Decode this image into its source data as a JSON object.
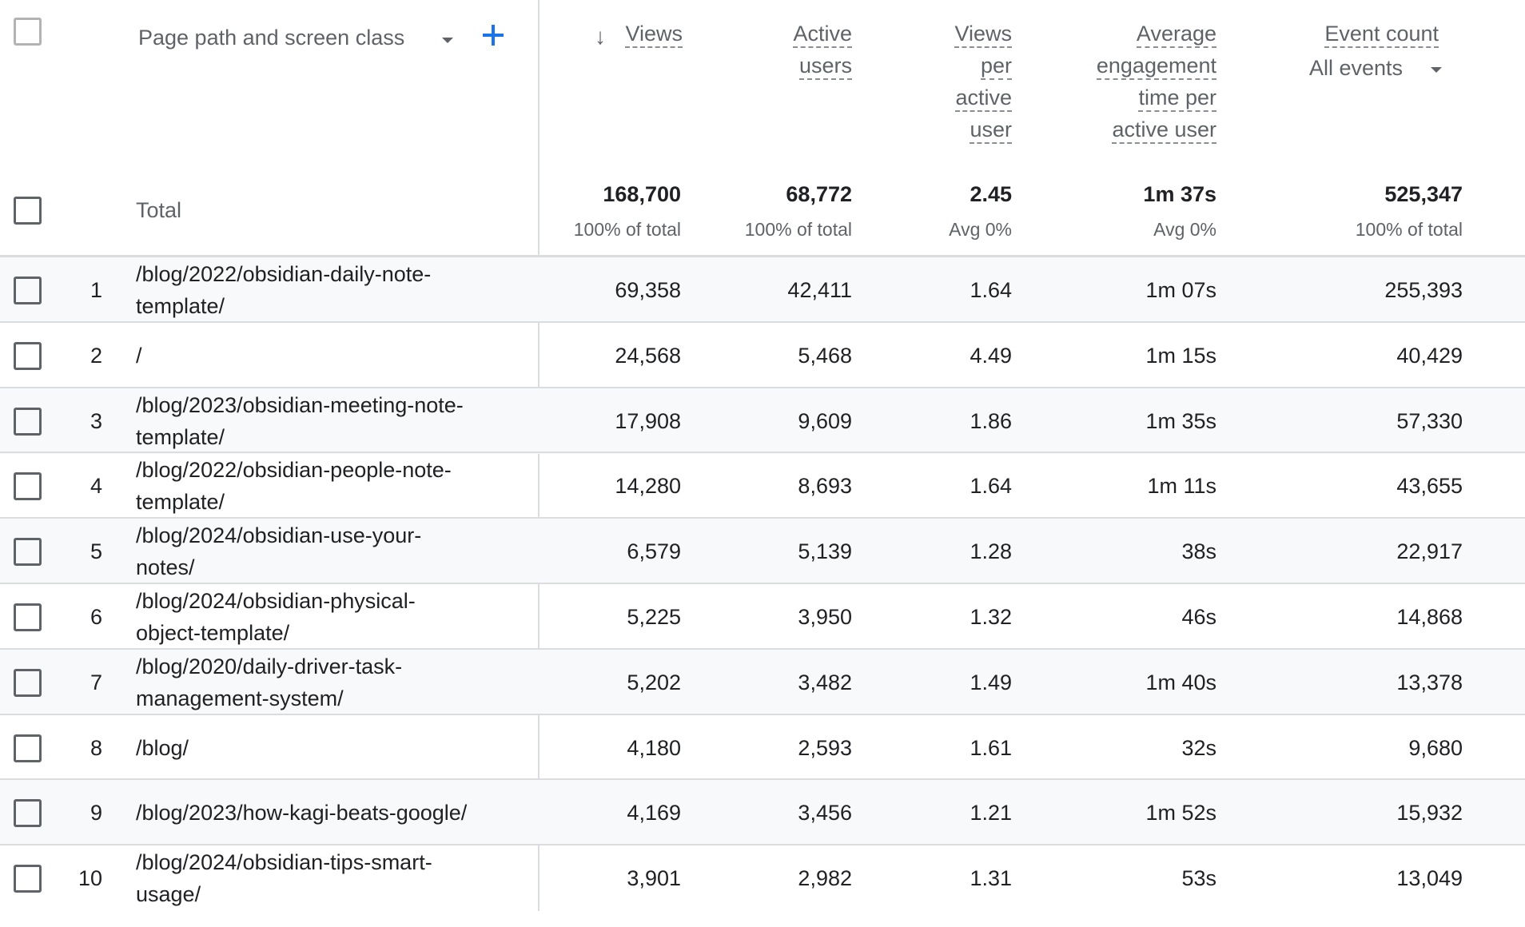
{
  "table": {
    "dimension_header": "Page path and screen class",
    "add_dimension_icon": "plus-icon",
    "dimension_dropdown_icon": "caret-down-icon",
    "sort_icon": "arrow-down-icon",
    "metrics": [
      {
        "key": "views",
        "label_lines": [
          "Views"
        ],
        "sorted": true
      },
      {
        "key": "active_users",
        "label_lines": [
          "Active",
          "users"
        ]
      },
      {
        "key": "views_per_user",
        "label_lines": [
          "Views",
          "per",
          "active",
          "user"
        ]
      },
      {
        "key": "avg_engagement",
        "label_lines": [
          "Average",
          "engagement",
          "time per",
          "active user"
        ]
      },
      {
        "key": "event_count",
        "label_lines": [
          "Event count"
        ],
        "selector": "All events"
      }
    ],
    "total": {
      "label": "Total",
      "values": [
        "168,700",
        "68,772",
        "2.45",
        "1m 37s",
        "525,347"
      ],
      "subs": [
        "100% of total",
        "100% of total",
        "Avg 0%",
        "Avg 0%",
        "100% of total"
      ]
    },
    "rows": [
      {
        "rank": "1",
        "path": "/blog/2022/obsidian-daily-note-template/",
        "path_lines": [
          "/blog/2022/obsidian-daily-note-",
          "template/"
        ],
        "values": [
          "69,358",
          "42,411",
          "1.64",
          "1m 07s",
          "255,393"
        ]
      },
      {
        "rank": "2",
        "path": "/",
        "path_lines": [
          "/"
        ],
        "values": [
          "24,568",
          "5,468",
          "4.49",
          "1m 15s",
          "40,429"
        ]
      },
      {
        "rank": "3",
        "path": "/blog/2023/obsidian-meeting-note-template/",
        "path_lines": [
          "/blog/2023/obsidian-meeting-note-",
          "template/"
        ],
        "values": [
          "17,908",
          "9,609",
          "1.86",
          "1m 35s",
          "57,330"
        ]
      },
      {
        "rank": "4",
        "path": "/blog/2022/obsidian-people-note-template/",
        "path_lines": [
          "/blog/2022/obsidian-people-note-",
          "template/"
        ],
        "values": [
          "14,280",
          "8,693",
          "1.64",
          "1m 11s",
          "43,655"
        ]
      },
      {
        "rank": "5",
        "path": "/blog/2024/obsidian-use-your-notes/",
        "path_lines": [
          "/blog/2024/obsidian-use-your-",
          "notes/"
        ],
        "values": [
          "6,579",
          "5,139",
          "1.28",
          "38s",
          "22,917"
        ]
      },
      {
        "rank": "6",
        "path": "/blog/2024/obsidian-physical-object-template/",
        "path_lines": [
          "/blog/2024/obsidian-physical-",
          "object-template/"
        ],
        "values": [
          "5,225",
          "3,950",
          "1.32",
          "46s",
          "14,868"
        ]
      },
      {
        "rank": "7",
        "path": "/blog/2020/daily-driver-task-management-system/",
        "path_lines": [
          "/blog/2020/daily-driver-task-",
          "management-system/"
        ],
        "values": [
          "5,202",
          "3,482",
          "1.49",
          "1m 40s",
          "13,378"
        ]
      },
      {
        "rank": "8",
        "path": "/blog/",
        "path_lines": [
          "/blog/"
        ],
        "values": [
          "4,180",
          "2,593",
          "1.61",
          "32s",
          "9,680"
        ]
      },
      {
        "rank": "9",
        "path": "/blog/2023/how-kagi-beats-google/",
        "path_lines": [
          "/blog/2023/how-kagi-beats-google/"
        ],
        "values": [
          "4,169",
          "3,456",
          "1.21",
          "1m 52s",
          "15,932"
        ]
      },
      {
        "rank": "10",
        "path": "/blog/2024/obsidian-tips-smart-usage/",
        "path_lines": [
          "/blog/2024/obsidian-tips-smart-",
          "usage/"
        ],
        "values": [
          "3,901",
          "2,982",
          "1.31",
          "53s",
          "13,049"
        ]
      }
    ]
  },
  "colors": {
    "accent": "#1a73e8",
    "stripe": "#f8f9fa",
    "border": "#dadce0",
    "header_text": "#5f6368",
    "body_text": "#202124"
  }
}
